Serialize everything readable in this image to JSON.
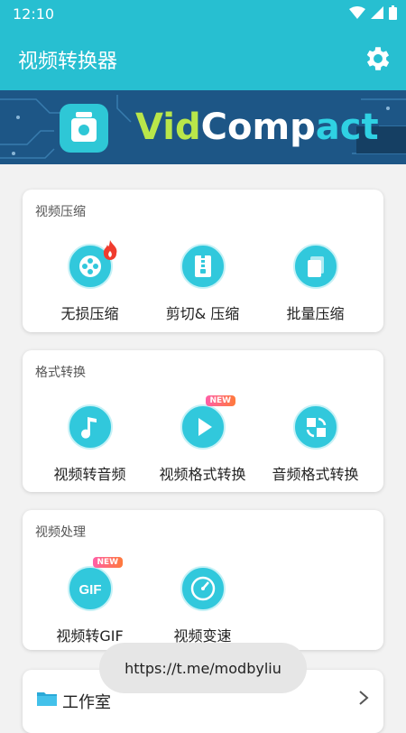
{
  "status_bar": {
    "time": "12:10"
  },
  "app_bar": {
    "title": "视频转换器"
  },
  "banner": {
    "brand_vid": "Vid",
    "brand_comp": "Comp",
    "brand_act": "act"
  },
  "sections": [
    {
      "title": "视频压缩",
      "items": [
        {
          "label": "无损压缩",
          "icon": "film-reel-icon",
          "badge": ""
        },
        {
          "label": "剪切& 压缩",
          "icon": "zip-icon",
          "badge": ""
        },
        {
          "label": "批量压缩",
          "icon": "stack-icon",
          "badge": ""
        }
      ]
    },
    {
      "title": "格式转换",
      "items": [
        {
          "label": "视频转音频",
          "icon": "music-note-icon",
          "badge": ""
        },
        {
          "label": "视频格式转换",
          "icon": "play-icon",
          "badge": "NEW"
        },
        {
          "label": "音频格式转换",
          "icon": "convert-icon",
          "badge": ""
        }
      ]
    },
    {
      "title": "视频处理",
      "items": [
        {
          "label": "视频转GIF",
          "icon": "gif-icon",
          "badge": "NEW"
        },
        {
          "label": "视频变速",
          "icon": "speedometer-icon",
          "badge": ""
        }
      ]
    }
  ],
  "toast": {
    "text": "https://t.me/modbyliu"
  },
  "workshop": {
    "title": "工作室"
  },
  "colors": {
    "primary": "#27bfd1",
    "icon": "#31c8dc"
  }
}
